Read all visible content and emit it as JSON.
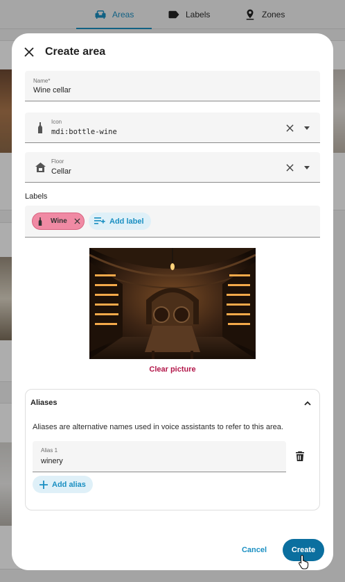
{
  "nav": {
    "tabs": [
      {
        "label": "Areas",
        "icon": "sofa-icon",
        "active": true
      },
      {
        "label": "Labels",
        "icon": "label-icon",
        "active": false
      },
      {
        "label": "Zones",
        "icon": "map-marker-icon",
        "active": false
      }
    ]
  },
  "dialog": {
    "title": "Create area",
    "name_field": {
      "label": "Name*",
      "value": "Wine cellar"
    },
    "icon_field": {
      "label": "Icon",
      "value": "mdi:bottle-wine",
      "icon": "bottle-wine-icon"
    },
    "floor_field": {
      "label": "Floor",
      "value": "Cellar",
      "icon": "home-floor-icon"
    },
    "labels_heading": "Labels",
    "labels": [
      {
        "label": "Wine",
        "color": "#f08aa4",
        "icon": "bottle-wine-icon"
      }
    ],
    "add_label": "Add label",
    "picture": {
      "clear_label": "Clear picture"
    },
    "aliases": {
      "title": "Aliases",
      "description": "Aliases are alternative names used in voice assistants to refer to this area.",
      "items": [
        {
          "label": "Alias 1",
          "value": "winery"
        }
      ],
      "add_label": "Add alias"
    },
    "actions": {
      "cancel": "Cancel",
      "create": "Create"
    }
  },
  "colors": {
    "accent": "#1a8fc2",
    "primary_button": "#0b6f9f",
    "clear_picture": "#b3174a"
  }
}
